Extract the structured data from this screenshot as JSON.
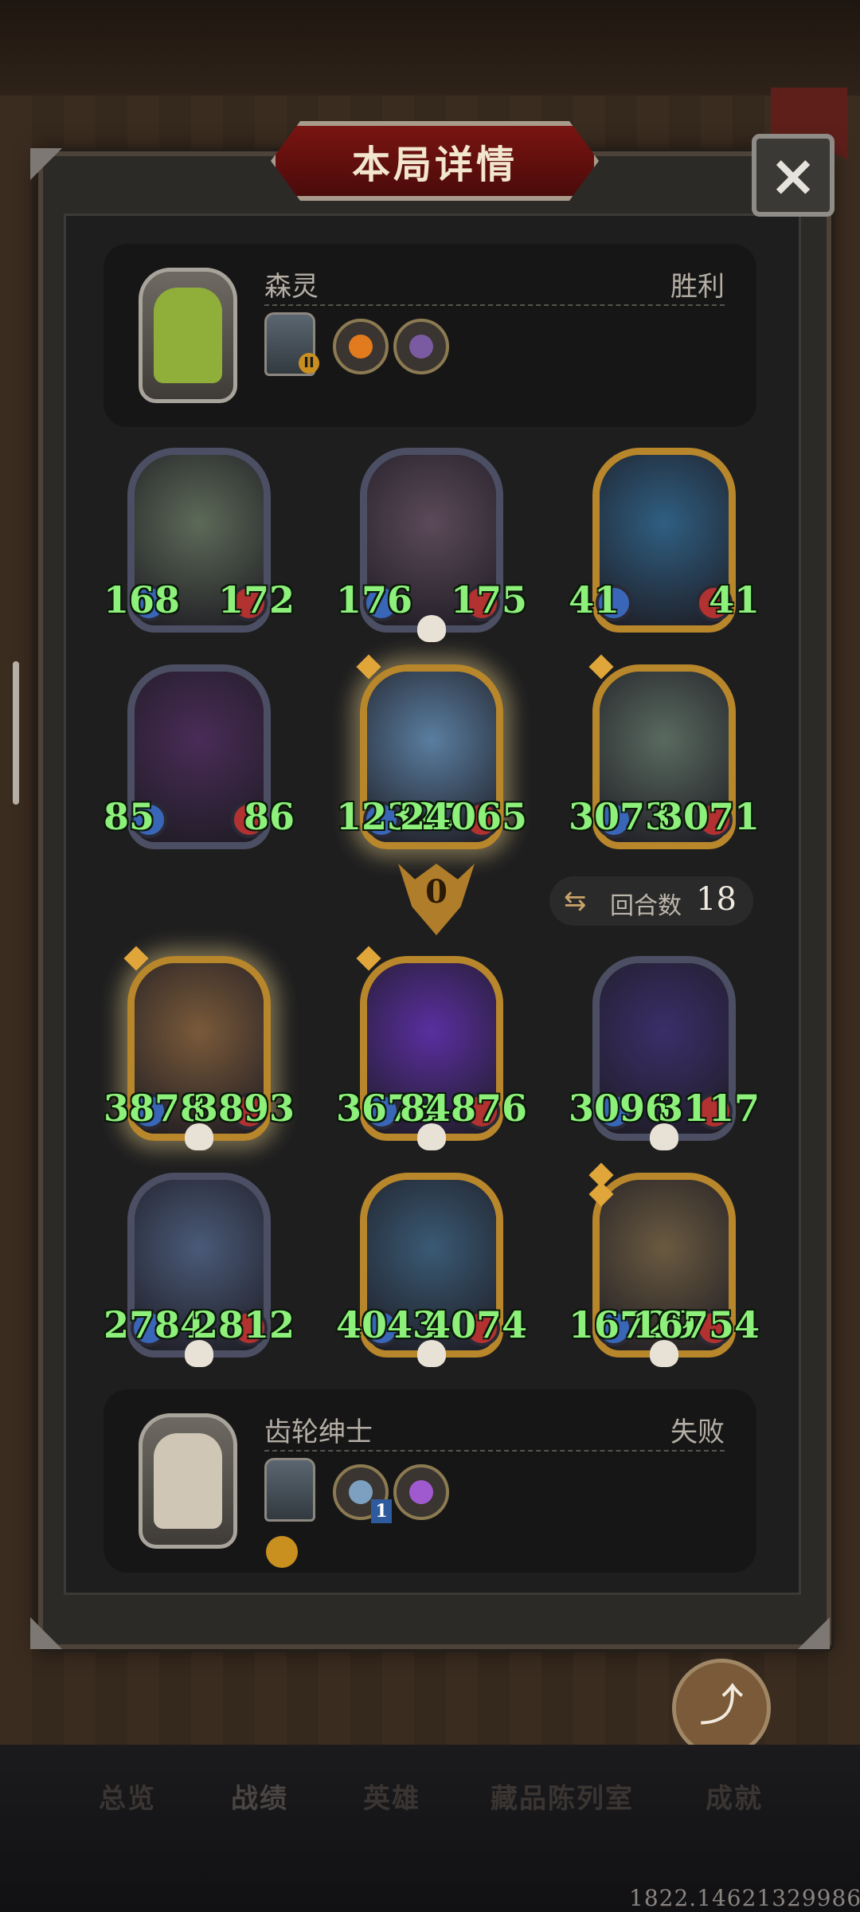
{
  "title": "本局详情",
  "close_glyph": "×",
  "top_player": {
    "name": "森灵",
    "result": "胜利",
    "equip_badge": "II",
    "trinket_colors": [
      "#e27a1e",
      "#7a5aa0"
    ],
    "portrait_color": "#8fae3a"
  },
  "bottom_player": {
    "name": "齿轮绅士",
    "result": "失败",
    "trinket_badge": "1",
    "trinket_colors": [
      "#7ea0c0",
      "#a05ad0"
    ],
    "portrait_color": "#cfc6b6"
  },
  "enemy_units": [
    {
      "atk": "168",
      "hp": "172",
      "art": "#5d6a58",
      "style": "plain"
    },
    {
      "atk": "176",
      "hp": "175",
      "art": "#5c4a5a",
      "style": "plain",
      "skull": true
    },
    {
      "atk": "41",
      "hp": "41",
      "art": "#2f5f82",
      "style": "gold"
    },
    {
      "atk": "85",
      "hp": "86",
      "art": "#4a2c58",
      "style": "plain"
    },
    {
      "atk": "12327",
      "hp": "24065",
      "art": "#5a7ea0",
      "style": "gold glow",
      "gem": true
    },
    {
      "atk": "3073",
      "hp": "3071",
      "art": "#596a60",
      "style": "gold",
      "gem": true
    }
  ],
  "round": {
    "arrow_value": "0",
    "label": "回合数",
    "value": "18"
  },
  "player_units": [
    {
      "atk": "3878",
      "hp": "3893",
      "art": "#7a5a3a",
      "style": "gold glow",
      "skull": true,
      "gem": true
    },
    {
      "atk": "3678",
      "hp": "84876",
      "art": "#5a2fa0",
      "style": "gold",
      "skull": true,
      "gem": true
    },
    {
      "atk": "3096",
      "hp": "3117",
      "art": "#3a2f6a",
      "style": "plain",
      "skull": true
    },
    {
      "atk": "2784",
      "hp": "2812",
      "art": "#4a5a78",
      "style": "plain",
      "skull": true
    },
    {
      "atk": "4043",
      "hp": "4074",
      "art": "#3a5a74",
      "style": "gold",
      "skull": true
    },
    {
      "atk": "16729",
      "hp": "16754",
      "art": "#6a5a40",
      "style": "gold",
      "skull": true,
      "gem": true,
      "gem2": true
    }
  ],
  "share": {
    "label": "分享",
    "icon": "share-icon"
  },
  "nav": {
    "overview": "总览",
    "records": "战绩",
    "heroes": "英雄",
    "collection": "藏品陈列室",
    "achievements": "成就"
  },
  "coords_text": "1822.14621329986"
}
